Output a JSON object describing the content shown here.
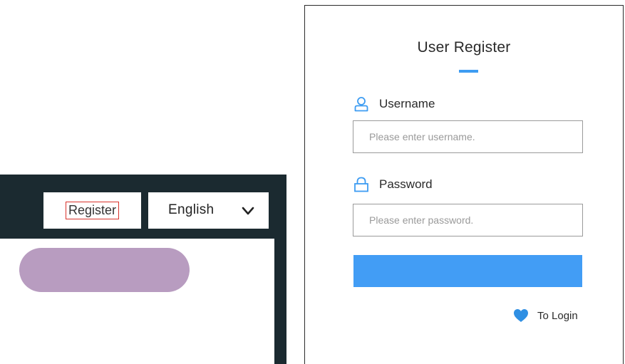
{
  "header": {
    "register_label": "Register",
    "language": {
      "selected": "English",
      "icon": "chevron-down-icon"
    }
  },
  "register_form": {
    "title": "User Register",
    "username": {
      "label": "Username",
      "placeholder": "Please enter username.",
      "value": "",
      "icon": "user-icon"
    },
    "password": {
      "label": "Password",
      "placeholder": "Please enter password.",
      "value": "",
      "icon": "lock-icon"
    },
    "submit_label": "",
    "to_login": {
      "label": "To Login",
      "icon": "heart-icon"
    }
  },
  "colors": {
    "header_bg": "#1b2a30",
    "accent": "#429df5",
    "highlight_border": "#d9322b",
    "placeholder_pill": "#b89cc0"
  }
}
